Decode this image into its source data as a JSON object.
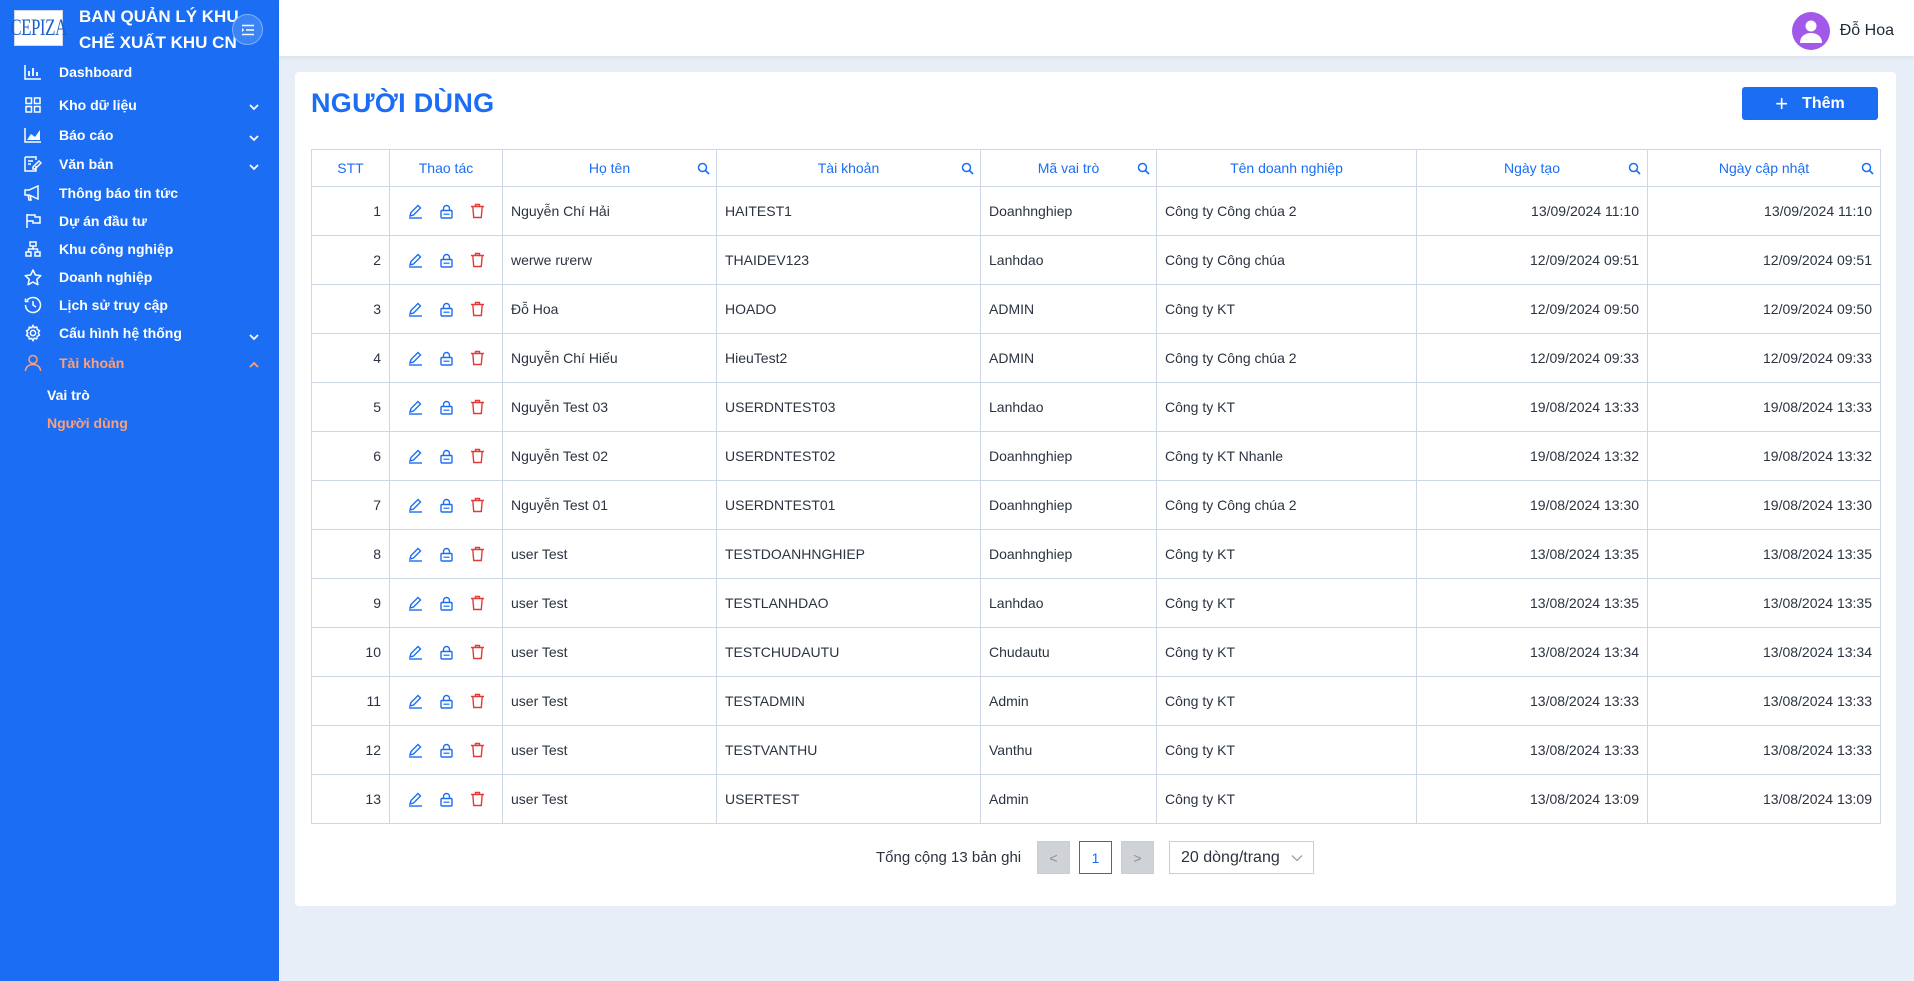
{
  "brand": {
    "logo_text": "CEPIZA",
    "title_line1": "BAN QUẢN LÝ KHU",
    "title_line2": "CHẾ XUẤT KHU CN"
  },
  "sidebar": {
    "items": [
      {
        "label": "Dashboard",
        "icon": "bar-chart-icon",
        "has_chevron": false
      },
      {
        "label": "Kho dữ liệu",
        "icon": "grid-icon",
        "has_chevron": true
      },
      {
        "label": "Báo cáo",
        "icon": "area-chart-icon",
        "has_chevron": true
      },
      {
        "label": "Văn bản",
        "icon": "document-icon",
        "has_chevron": true
      },
      {
        "label": "Thông báo tin tức",
        "icon": "megaphone-icon",
        "has_chevron": false
      },
      {
        "label": "Dự án đầu tư",
        "icon": "flag-icon",
        "has_chevron": false
      },
      {
        "label": "Khu công nghiệp",
        "icon": "sitemap-icon",
        "has_chevron": false
      },
      {
        "label": "Doanh nghiệp",
        "icon": "star-icon",
        "has_chevron": false
      },
      {
        "label": "Lịch sử truy cập",
        "icon": "history-icon",
        "has_chevron": false
      },
      {
        "label": "Cấu hình hệ thống",
        "icon": "gear-icon",
        "has_chevron": true
      },
      {
        "label": "Tài khoản",
        "icon": "user-icon",
        "has_chevron": true,
        "expanded": true,
        "active": true
      }
    ],
    "sub_items": [
      {
        "label": "Vai trò",
        "active": false
      },
      {
        "label": "Người dùng",
        "active": true
      }
    ]
  },
  "topbar": {
    "user_name": "Đỗ Hoa"
  },
  "page": {
    "title": "NGƯỜI DÙNG",
    "add_button": "Thêm"
  },
  "table": {
    "columns": [
      "STT",
      "Thao tác",
      "Họ tên",
      "Tài khoản",
      "Mã vai trò",
      "Tên doanh nghiệp",
      "Ngày tạo",
      "Ngày cập nhật"
    ],
    "rows": [
      {
        "stt": "1",
        "ho_ten": "Nguyễn Chí Hải",
        "tai_khoan": "HAITEST1",
        "ma_vai_tro": "Doanhnghiep",
        "ten_dn": "Công ty Công chúa 2",
        "ngay_tao": "13/09/2024 11:10",
        "ngay_cap_nhat": "13/09/2024 11:10"
      },
      {
        "stt": "2",
        "ho_ten": "werwe rưerw",
        "tai_khoan": "THAIDEV123",
        "ma_vai_tro": "Lanhdao",
        "ten_dn": "Công ty Công chúa",
        "ngay_tao": "12/09/2024 09:51",
        "ngay_cap_nhat": "12/09/2024 09:51"
      },
      {
        "stt": "3",
        "ho_ten": "Đỗ Hoa",
        "tai_khoan": "HOADO",
        "ma_vai_tro": "ADMIN",
        "ten_dn": "Công ty KT",
        "ngay_tao": "12/09/2024 09:50",
        "ngay_cap_nhat": "12/09/2024 09:50"
      },
      {
        "stt": "4",
        "ho_ten": "Nguyễn Chí Hiếu",
        "tai_khoan": "HieuTest2",
        "ma_vai_tro": "ADMIN",
        "ten_dn": "Công ty Công chúa 2",
        "ngay_tao": "12/09/2024 09:33",
        "ngay_cap_nhat": "12/09/2024 09:33"
      },
      {
        "stt": "5",
        "ho_ten": "Nguyễn Test 03",
        "tai_khoan": "USERDNTEST03",
        "ma_vai_tro": "Lanhdao",
        "ten_dn": "Công ty KT",
        "ngay_tao": "19/08/2024 13:33",
        "ngay_cap_nhat": "19/08/2024 13:33"
      },
      {
        "stt": "6",
        "ho_ten": "Nguyễn Test 02",
        "tai_khoan": "USERDNTEST02",
        "ma_vai_tro": "Doanhnghiep",
        "ten_dn": "Công ty KT Nhanle",
        "ngay_tao": "19/08/2024 13:32",
        "ngay_cap_nhat": "19/08/2024 13:32"
      },
      {
        "stt": "7",
        "ho_ten": "Nguyễn Test 01",
        "tai_khoan": "USERDNTEST01",
        "ma_vai_tro": "Doanhnghiep",
        "ten_dn": "Công ty Công chúa 2",
        "ngay_tao": "19/08/2024 13:30",
        "ngay_cap_nhat": "19/08/2024 13:30"
      },
      {
        "stt": "8",
        "ho_ten": "user Test",
        "tai_khoan": "TESTDOANHNGHIEP",
        "ma_vai_tro": "Doanhnghiep",
        "ten_dn": "Công ty KT",
        "ngay_tao": "13/08/2024 13:35",
        "ngay_cap_nhat": "13/08/2024 13:35"
      },
      {
        "stt": "9",
        "ho_ten": "user Test",
        "tai_khoan": "TESTLANHDAO",
        "ma_vai_tro": "Lanhdao",
        "ten_dn": "Công ty KT",
        "ngay_tao": "13/08/2024 13:35",
        "ngay_cap_nhat": "13/08/2024 13:35"
      },
      {
        "stt": "10",
        "ho_ten": "user Test",
        "tai_khoan": "TESTCHUDAUTU",
        "ma_vai_tro": "Chudautu",
        "ten_dn": "Công ty KT",
        "ngay_tao": "13/08/2024 13:34",
        "ngay_cap_nhat": "13/08/2024 13:34"
      },
      {
        "stt": "11",
        "ho_ten": "user Test",
        "tai_khoan": "TESTADMIN",
        "ma_vai_tro": "Admin",
        "ten_dn": "Công ty KT",
        "ngay_tao": "13/08/2024 13:33",
        "ngay_cap_nhat": "13/08/2024 13:33"
      },
      {
        "stt": "12",
        "ho_ten": "user Test",
        "tai_khoan": "TESTVANTHU",
        "ma_vai_tro": "Vanthu",
        "ten_dn": "Công ty KT",
        "ngay_tao": "13/08/2024 13:33",
        "ngay_cap_nhat": "13/08/2024 13:33"
      },
      {
        "stt": "13",
        "ho_ten": "user Test",
        "tai_khoan": "USERTEST",
        "ma_vai_tro": "Admin",
        "ten_dn": "Công ty KT",
        "ngay_tao": "13/08/2024 13:09",
        "ngay_cap_nhat": "13/08/2024 13:09"
      }
    ]
  },
  "pagination": {
    "total_text": "Tổng cộng 13 bản ghi",
    "prev": "<",
    "current_page": "1",
    "next": ">",
    "page_size": "20 dòng/trang"
  },
  "colors": {
    "primary": "#1b6ef3",
    "active_menu": "#ff9f76",
    "delete": "#e53935",
    "avatar": "#a259e9"
  }
}
